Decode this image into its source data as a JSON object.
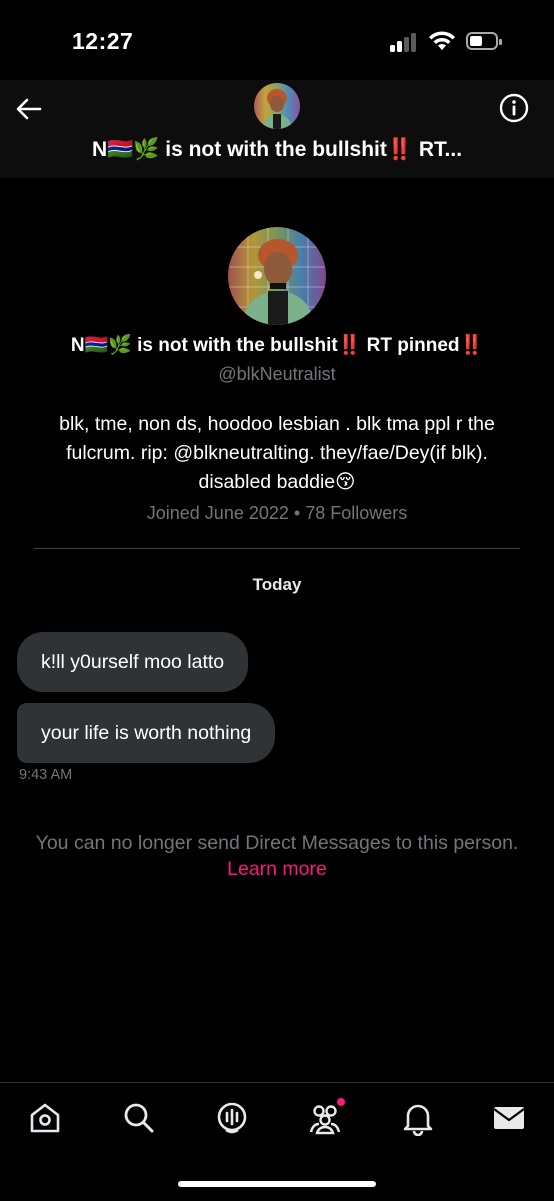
{
  "status": {
    "time": "12:27"
  },
  "header": {
    "title": "N🇬🇲🌿 is not with the bullshit‼️ RT...",
    "back_icon": "arrow-left-icon",
    "info_icon": "info-icon"
  },
  "profile": {
    "name": "N🇬🇲🌿 is not with the bullshit‼️ RT pinned‼️",
    "handle": "@blkNeutralist",
    "bio": "blk, tme, non ds, hoodoo lesbian . blk tma ppl r the fulcrum. rip: @blkneutralting. they/fae/Dey(if blk). disabled baddie😚",
    "meta": "Joined June 2022 • 78 Followers"
  },
  "conversation": {
    "date_label": "Today",
    "messages": [
      {
        "text": "k!ll y0urself moo latto"
      },
      {
        "text": "your life is worth nothing"
      }
    ],
    "time": "9:43 AM"
  },
  "notice": {
    "text": "You can no longer send Direct Messages to this person.",
    "link": "Learn more"
  },
  "tabs": [
    {
      "icon": "home-icon"
    },
    {
      "icon": "search-icon"
    },
    {
      "icon": "spaces-icon"
    },
    {
      "icon": "communities-icon",
      "badge": true
    },
    {
      "icon": "notifications-icon"
    },
    {
      "icon": "messages-icon"
    }
  ],
  "colors": {
    "background": "#000000",
    "bubble": "#2f3336",
    "muted": "#71767b",
    "accent_link": "#f91880"
  }
}
